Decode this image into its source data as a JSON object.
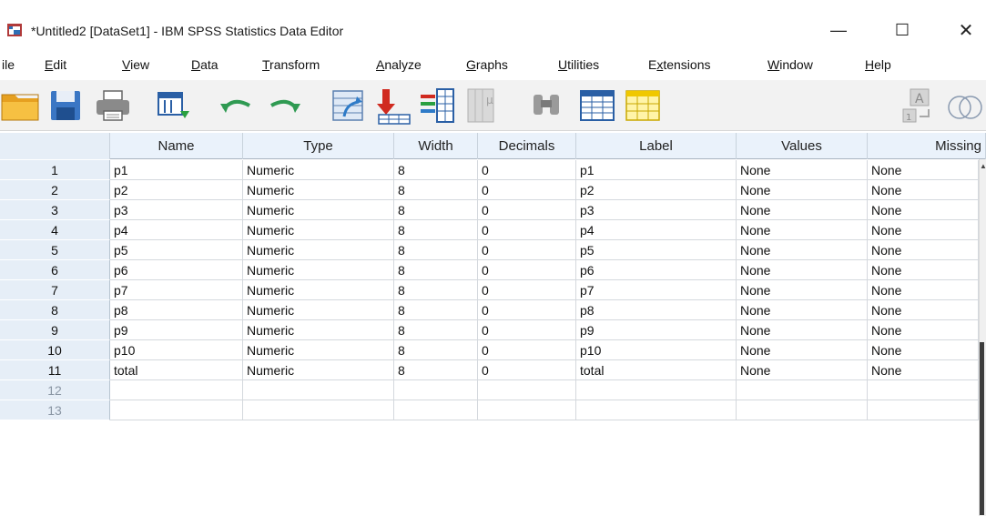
{
  "window": {
    "title": "*Untitled2 [DataSet1] - IBM SPSS Statistics Data Editor",
    "minimize": "—",
    "maximize": "☐",
    "close": "✕"
  },
  "menu": [
    {
      "pre": "",
      "u": "",
      "post": "ile"
    },
    {
      "pre": "",
      "u": "E",
      "post": "dit"
    },
    {
      "pre": "",
      "u": "V",
      "post": "iew"
    },
    {
      "pre": "",
      "u": "D",
      "post": "ata"
    },
    {
      "pre": "",
      "u": "T",
      "post": "ransform"
    },
    {
      "pre": "",
      "u": "A",
      "post": "nalyze"
    },
    {
      "pre": "",
      "u": "G",
      "post": "raphs"
    },
    {
      "pre": "",
      "u": "U",
      "post": "tilities"
    },
    {
      "pre": "E",
      "u": "x",
      "post": "tensions"
    },
    {
      "pre": "",
      "u": "W",
      "post": "indow"
    },
    {
      "pre": "",
      "u": "H",
      "post": "elp"
    }
  ],
  "toolbar": [
    "open-folder-icon",
    "save-icon",
    "print-icon",
    "dialog-recall-icon",
    "undo-icon",
    "redo-icon",
    "goto-case-icon",
    "goto-variable-icon",
    "variables-icon",
    "run-descriptives-icon",
    "find-icon",
    "insert-cases-icon",
    "insert-variable-icon",
    "value-labels-icon",
    "use-sets-icon"
  ],
  "columns": [
    "Name",
    "Type",
    "Width",
    "Decimals",
    "Label",
    "Values",
    "Missing"
  ],
  "rows": [
    {
      "num": "1",
      "name": "p1",
      "type": "Numeric",
      "width": "8",
      "decimals": "0",
      "label": "p1",
      "values": "None",
      "missing": "None"
    },
    {
      "num": "2",
      "name": "p2",
      "type": "Numeric",
      "width": "8",
      "decimals": "0",
      "label": "p2",
      "values": "None",
      "missing": "None"
    },
    {
      "num": "3",
      "name": "p3",
      "type": "Numeric",
      "width": "8",
      "decimals": "0",
      "label": "p3",
      "values": "None",
      "missing": "None"
    },
    {
      "num": "4",
      "name": "p4",
      "type": "Numeric",
      "width": "8",
      "decimals": "0",
      "label": "p4",
      "values": "None",
      "missing": "None"
    },
    {
      "num": "5",
      "name": "p5",
      "type": "Numeric",
      "width": "8",
      "decimals": "0",
      "label": "p5",
      "values": "None",
      "missing": "None"
    },
    {
      "num": "6",
      "name": "p6",
      "type": "Numeric",
      "width": "8",
      "decimals": "0",
      "label": "p6",
      "values": "None",
      "missing": "None"
    },
    {
      "num": "7",
      "name": "p7",
      "type": "Numeric",
      "width": "8",
      "decimals": "0",
      "label": "p7",
      "values": "None",
      "missing": "None"
    },
    {
      "num": "8",
      "name": "p8",
      "type": "Numeric",
      "width": "8",
      "decimals": "0",
      "label": "p8",
      "values": "None",
      "missing": "None"
    },
    {
      "num": "9",
      "name": "p9",
      "type": "Numeric",
      "width": "8",
      "decimals": "0",
      "label": "p9",
      "values": "None",
      "missing": "None"
    },
    {
      "num": "10",
      "name": "p10",
      "type": "Numeric",
      "width": "8",
      "decimals": "0",
      "label": "p10",
      "values": "None",
      "missing": "None"
    },
    {
      "num": "11",
      "name": "total",
      "type": "Numeric",
      "width": "8",
      "decimals": "0",
      "label": "total",
      "values": "None",
      "missing": "None"
    },
    {
      "num": "12",
      "name": "",
      "type": "",
      "width": "",
      "decimals": "",
      "label": "",
      "values": "",
      "missing": ""
    },
    {
      "num": "13",
      "name": "",
      "type": "",
      "width": "",
      "decimals": "",
      "label": "",
      "values": "",
      "missing": ""
    }
  ]
}
